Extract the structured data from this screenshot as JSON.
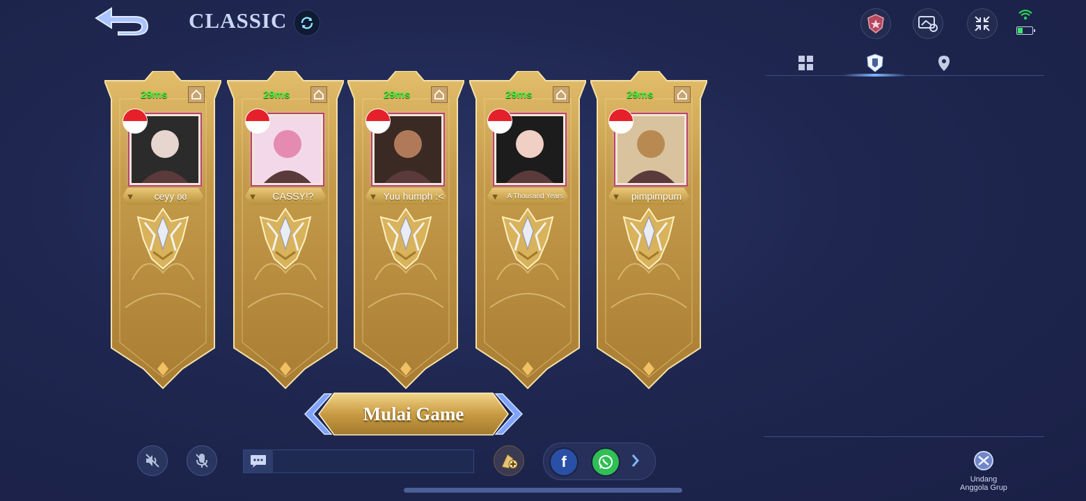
{
  "header": {
    "mode_title": "CLASSIC",
    "icons": [
      "back-arrow-icon",
      "refresh-icon",
      "rank-shield-icon",
      "share-screen-icon",
      "collapse-icon",
      "wifi-icon",
      "battery-icon"
    ]
  },
  "side_tabs": [
    "grid-icon",
    "emblem-shield-icon",
    "location-pin-icon"
  ],
  "party": [
    {
      "ping": "29ms",
      "name": "ceyy ʚɞ",
      "country": "Indonesia"
    },
    {
      "ping": "29ms",
      "name": "CASSY!?",
      "country": "Indonesia"
    },
    {
      "ping": "29ms",
      "name": "Yuu humph :<",
      "country": "Indonesia"
    },
    {
      "ping": "29ms",
      "name": "A Thousand Years",
      "country": "Indonesia"
    },
    {
      "ping": "29ms",
      "name": "pimpimpum",
      "country": "Indonesia"
    }
  ],
  "start_button": "Mulai Game",
  "invite": {
    "label_line1": "Undang",
    "label_line2": "Anggola Grup"
  },
  "colors": {
    "ping": "#3ef23e",
    "gold": "#d4a64a",
    "bg": "#1f2750"
  },
  "status": {
    "battery_level": 0.35
  }
}
